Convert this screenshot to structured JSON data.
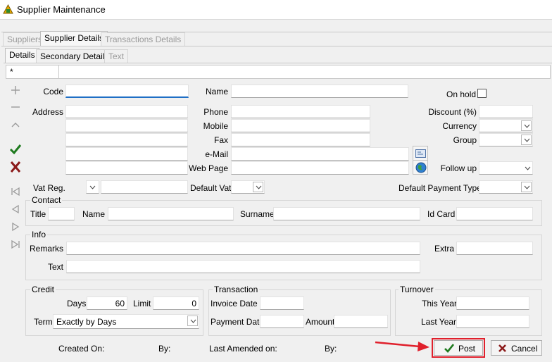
{
  "window": {
    "title": "Supplier Maintenance"
  },
  "main_tabs": [
    {
      "label": "Suppliers"
    },
    {
      "label": "Supplier Details"
    },
    {
      "label": "Transactions Details"
    }
  ],
  "sub_tabs": [
    {
      "label": "Details"
    },
    {
      "label": "Secondary Details"
    },
    {
      "label": "Text"
    }
  ],
  "record_row": {
    "indicator": "*"
  },
  "labels": {
    "code": "Code",
    "name": "Name",
    "on_hold": "On hold",
    "address": "Address",
    "phone": "Phone",
    "mobile": "Mobile",
    "fax": "Fax",
    "email": "e-Mail",
    "web_page": "Web Page",
    "discount": "Discount (%)",
    "currency": "Currency",
    "group": "Group",
    "follow_up": "Follow up",
    "vat_reg": "Vat Reg.",
    "default_vat": "Default Vat",
    "default_payment_type": "Default Payment Type"
  },
  "contact": {
    "legend": "Contact",
    "title": "Title",
    "name": "Name",
    "surname": "Surname",
    "id_card": "Id Card"
  },
  "info": {
    "legend": "Info",
    "remarks": "Remarks",
    "extra": "Extra",
    "text": "Text"
  },
  "credit": {
    "legend": "Credit",
    "days_label": "Days",
    "days_value": "60",
    "limit_label": "Limit",
    "limit_value": "0",
    "term_label": "Term",
    "term_value": "Exactly by Days"
  },
  "transaction": {
    "legend": "Transaction",
    "invoice_date": "Invoice Date",
    "payment_date": "Payment Date",
    "amount": "Amount"
  },
  "turnover": {
    "legend": "Turnover",
    "this_year": "This Year",
    "last_year": "Last Year"
  },
  "footer": {
    "created_on": "Created On:",
    "by1": "By:",
    "last_amended": "Last Amended on:",
    "by2": "By:"
  },
  "buttons": {
    "post": "Post",
    "cancel": "Cancel"
  },
  "colors": {
    "accent": "#1f6fc5",
    "post_highlight": "#e0202c",
    "check_green": "#1e7a1e",
    "cancel_red": "#8b1a1a"
  },
  "icons": [
    "app-icon",
    "add-icon",
    "remove-icon",
    "up-icon",
    "check-icon",
    "cross-icon",
    "first-icon",
    "prev-icon",
    "next-icon",
    "last-icon",
    "email-card-icon",
    "globe-icon",
    "chevron-down-icon"
  ]
}
